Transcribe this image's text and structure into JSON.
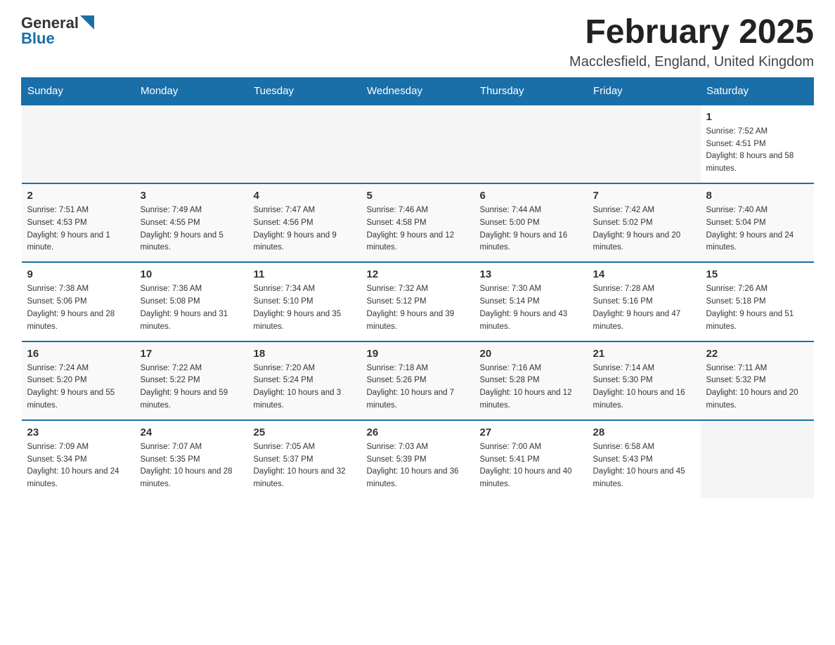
{
  "header": {
    "logo_general": "General",
    "logo_blue": "Blue",
    "title": "February 2025",
    "subtitle": "Macclesfield, England, United Kingdom"
  },
  "weekdays": [
    "Sunday",
    "Monday",
    "Tuesday",
    "Wednesday",
    "Thursday",
    "Friday",
    "Saturday"
  ],
  "weeks": [
    [
      {
        "day": "",
        "info": ""
      },
      {
        "day": "",
        "info": ""
      },
      {
        "day": "",
        "info": ""
      },
      {
        "day": "",
        "info": ""
      },
      {
        "day": "",
        "info": ""
      },
      {
        "day": "",
        "info": ""
      },
      {
        "day": "1",
        "info": "Sunrise: 7:52 AM\nSunset: 4:51 PM\nDaylight: 8 hours and 58 minutes."
      }
    ],
    [
      {
        "day": "2",
        "info": "Sunrise: 7:51 AM\nSunset: 4:53 PM\nDaylight: 9 hours and 1 minute."
      },
      {
        "day": "3",
        "info": "Sunrise: 7:49 AM\nSunset: 4:55 PM\nDaylight: 9 hours and 5 minutes."
      },
      {
        "day": "4",
        "info": "Sunrise: 7:47 AM\nSunset: 4:56 PM\nDaylight: 9 hours and 9 minutes."
      },
      {
        "day": "5",
        "info": "Sunrise: 7:46 AM\nSunset: 4:58 PM\nDaylight: 9 hours and 12 minutes."
      },
      {
        "day": "6",
        "info": "Sunrise: 7:44 AM\nSunset: 5:00 PM\nDaylight: 9 hours and 16 minutes."
      },
      {
        "day": "7",
        "info": "Sunrise: 7:42 AM\nSunset: 5:02 PM\nDaylight: 9 hours and 20 minutes."
      },
      {
        "day": "8",
        "info": "Sunrise: 7:40 AM\nSunset: 5:04 PM\nDaylight: 9 hours and 24 minutes."
      }
    ],
    [
      {
        "day": "9",
        "info": "Sunrise: 7:38 AM\nSunset: 5:06 PM\nDaylight: 9 hours and 28 minutes."
      },
      {
        "day": "10",
        "info": "Sunrise: 7:36 AM\nSunset: 5:08 PM\nDaylight: 9 hours and 31 minutes."
      },
      {
        "day": "11",
        "info": "Sunrise: 7:34 AM\nSunset: 5:10 PM\nDaylight: 9 hours and 35 minutes."
      },
      {
        "day": "12",
        "info": "Sunrise: 7:32 AM\nSunset: 5:12 PM\nDaylight: 9 hours and 39 minutes."
      },
      {
        "day": "13",
        "info": "Sunrise: 7:30 AM\nSunset: 5:14 PM\nDaylight: 9 hours and 43 minutes."
      },
      {
        "day": "14",
        "info": "Sunrise: 7:28 AM\nSunset: 5:16 PM\nDaylight: 9 hours and 47 minutes."
      },
      {
        "day": "15",
        "info": "Sunrise: 7:26 AM\nSunset: 5:18 PM\nDaylight: 9 hours and 51 minutes."
      }
    ],
    [
      {
        "day": "16",
        "info": "Sunrise: 7:24 AM\nSunset: 5:20 PM\nDaylight: 9 hours and 55 minutes."
      },
      {
        "day": "17",
        "info": "Sunrise: 7:22 AM\nSunset: 5:22 PM\nDaylight: 9 hours and 59 minutes."
      },
      {
        "day": "18",
        "info": "Sunrise: 7:20 AM\nSunset: 5:24 PM\nDaylight: 10 hours and 3 minutes."
      },
      {
        "day": "19",
        "info": "Sunrise: 7:18 AM\nSunset: 5:26 PM\nDaylight: 10 hours and 7 minutes."
      },
      {
        "day": "20",
        "info": "Sunrise: 7:16 AM\nSunset: 5:28 PM\nDaylight: 10 hours and 12 minutes."
      },
      {
        "day": "21",
        "info": "Sunrise: 7:14 AM\nSunset: 5:30 PM\nDaylight: 10 hours and 16 minutes."
      },
      {
        "day": "22",
        "info": "Sunrise: 7:11 AM\nSunset: 5:32 PM\nDaylight: 10 hours and 20 minutes."
      }
    ],
    [
      {
        "day": "23",
        "info": "Sunrise: 7:09 AM\nSunset: 5:34 PM\nDaylight: 10 hours and 24 minutes."
      },
      {
        "day": "24",
        "info": "Sunrise: 7:07 AM\nSunset: 5:35 PM\nDaylight: 10 hours and 28 minutes."
      },
      {
        "day": "25",
        "info": "Sunrise: 7:05 AM\nSunset: 5:37 PM\nDaylight: 10 hours and 32 minutes."
      },
      {
        "day": "26",
        "info": "Sunrise: 7:03 AM\nSunset: 5:39 PM\nDaylight: 10 hours and 36 minutes."
      },
      {
        "day": "27",
        "info": "Sunrise: 7:00 AM\nSunset: 5:41 PM\nDaylight: 10 hours and 40 minutes."
      },
      {
        "day": "28",
        "info": "Sunrise: 6:58 AM\nSunset: 5:43 PM\nDaylight: 10 hours and 45 minutes."
      },
      {
        "day": "",
        "info": ""
      }
    ]
  ]
}
